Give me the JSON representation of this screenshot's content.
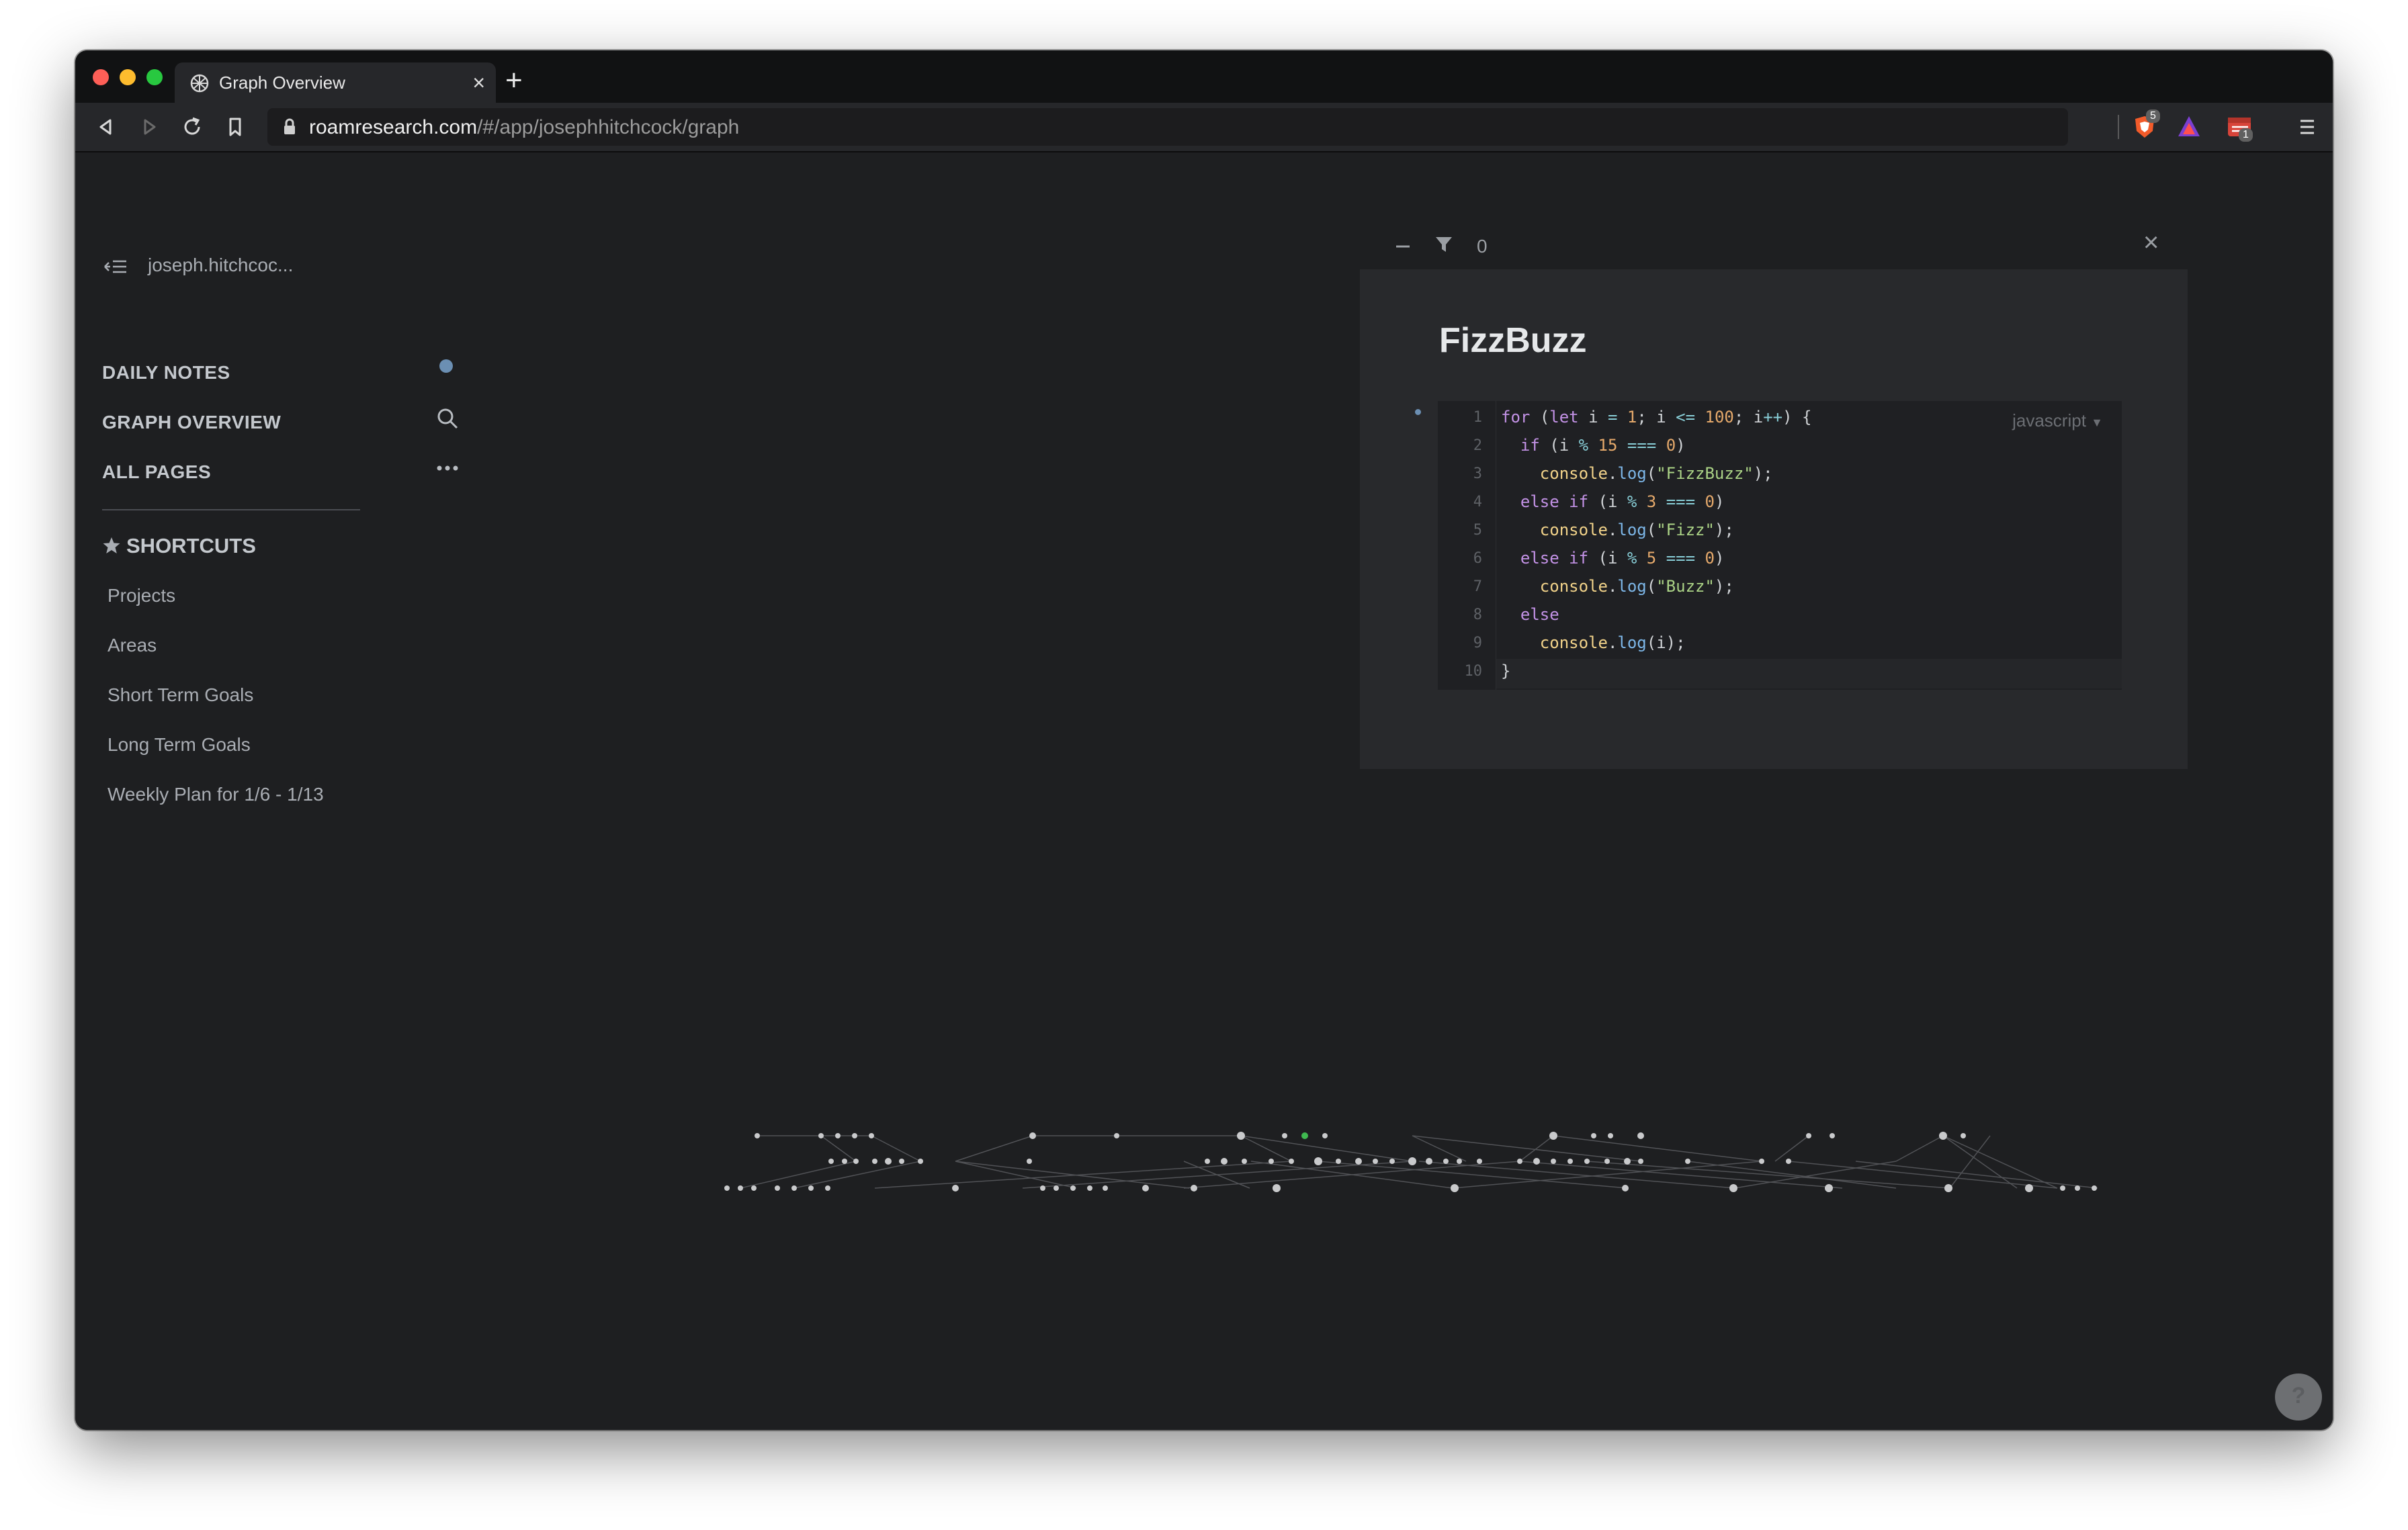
{
  "browser": {
    "tab_title": "Graph Overview",
    "tab_close": "×",
    "new_tab": "+",
    "url_host": "roamresearch.com",
    "url_path": "/#/app/josephhitchcock/graph",
    "ext_brave_badge": "5",
    "ext_todoist_badge": "1"
  },
  "sidebar": {
    "user": "joseph.hitchcoc...",
    "nav": {
      "daily_notes": "DAILY NOTES",
      "graph_overview": "GRAPH OVERVIEW",
      "all_pages": "ALL PAGES"
    },
    "shortcuts_title": "SHORTCUTS",
    "shortcuts": [
      "Projects",
      "Areas",
      "Short Term Goals",
      "Long Term Goals",
      "Weekly Plan for 1/6 - 1/13"
    ]
  },
  "panel": {
    "filter_count": "0",
    "close": "×",
    "title": "FizzBuzz",
    "code_language": "javascript",
    "line_numbers": [
      "1",
      "2",
      "3",
      "4",
      "5",
      "6",
      "7",
      "8",
      "9",
      "10"
    ],
    "code_lines": [
      "for (let i = 1; i <= 100; i++) {",
      "  if (i % 15 === 0)",
      "    console.log(\"FizzBuzz\");",
      "  else if (i % 3 === 0)",
      "    console.log(\"Fizz\");",
      "  else if (i % 5 === 0)",
      "    console.log(\"Buzz\");",
      "  else",
      "    console.log(i);",
      "}"
    ]
  },
  "help_label": "?",
  "colors": {
    "background": "#1e1f21",
    "panel": "#28292c",
    "accent_dot": "#6b8fb3",
    "keyword": "#c392e6",
    "number": "#e5a96b",
    "string": "#abd386"
  }
}
